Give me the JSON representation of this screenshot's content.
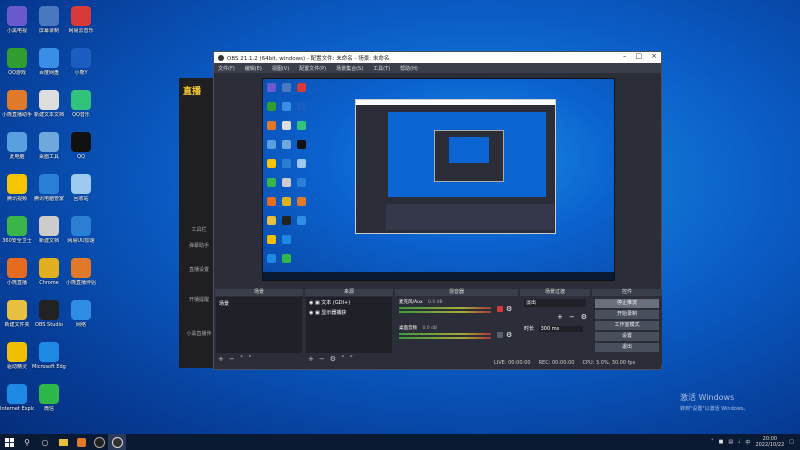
{
  "desktop": {
    "icons": [
      {
        "label": "小黑电视",
        "color": "#6a5acd"
      },
      {
        "label": "QQ游戏",
        "color": "#2f9d2f"
      },
      {
        "label": "小熊直播助手",
        "color": "#e07a2a"
      },
      {
        "label": "此电脑",
        "color": "#5aa0e0"
      },
      {
        "label": "腾讯视频",
        "color": "#f5c400"
      },
      {
        "label": "360安全卫士",
        "color": "#39b54a"
      },
      {
        "label": "小熊直播",
        "color": "#e56b1f"
      },
      {
        "label": "新建文件夹",
        "color": "#e8c040"
      },
      {
        "label": "驱动精灵",
        "color": "#f0c000"
      },
      {
        "label": "Internet Explorer",
        "color": "#1e88e5"
      },
      {
        "label": "屏幕录制",
        "color": "#4a78c0"
      },
      {
        "label": "百度网盘",
        "color": "#3a8ee6"
      },
      {
        "label": "新建文本文档",
        "color": "#dddddd"
      },
      {
        "label": "桌面工具",
        "color": "#6fa8dc"
      },
      {
        "label": "腾讯电脑管家",
        "color": "#2a7fd4"
      },
      {
        "label": "新建文档",
        "color": "#cccccc"
      },
      {
        "label": "Chrome",
        "color": "#e0b020"
      },
      {
        "label": "OBS Studio",
        "color": "#222222"
      },
      {
        "label": "Microsoft Edge",
        "color": "#1e88e5"
      },
      {
        "label": "微信",
        "color": "#2fb84a"
      },
      {
        "label": "网易云音乐",
        "color": "#d83a3a"
      },
      {
        "label": "小熊Y",
        "color": "#1a5cbf"
      },
      {
        "label": "QQ音乐",
        "color": "#31c27c"
      },
      {
        "label": "QQ",
        "color": "#111111"
      },
      {
        "label": "回收站",
        "color": "#9ec9ef"
      },
      {
        "label": "网易UU加速",
        "color": "#2a7fd4"
      },
      {
        "label": "小熊直播伴侣",
        "color": "#e07a2a"
      },
      {
        "label": "网络",
        "color": "#2f8de6"
      }
    ]
  },
  "background_app": {
    "logo": "直播",
    "items": [
      "工具栏",
      "弹幕助手",
      "直播设置",
      "开播提醒",
      "小黑直播伴"
    ]
  },
  "obs": {
    "title": "OBS 21.1.2 (64bit, windows) - 配置文件: 未命名 - 场景: 未命名",
    "menu": [
      "文件(F)",
      "编辑(E)",
      "视图(V)",
      "配置文件(P)",
      "场景集合(S)",
      "工具(T)",
      "帮助(H)"
    ],
    "docks": {
      "scenes": {
        "header": "场景",
        "items": [
          "场景"
        ]
      },
      "sources": {
        "header": "来源",
        "items": [
          "文本 (GDI+)",
          "显示器捕获"
        ]
      },
      "mixer": {
        "header": "混音器",
        "tracks": [
          {
            "name": "麦克风/Aux",
            "level": "0.0 dB"
          },
          {
            "name": "桌面音频",
            "level": "0.0 dB"
          }
        ]
      },
      "transitions": {
        "header": "场景过渡",
        "type": "淡出",
        "duration_label": "时长",
        "duration": "300 ms"
      },
      "controls": {
        "header": "控件",
        "buttons": [
          "停止推流",
          "开始录制",
          "工作室模式",
          "设置",
          "退出"
        ]
      }
    },
    "status": {
      "live": "LIVE: 00:00:00",
      "rec": "REC: 00:00:00",
      "cpu": "CPU: 3.0%, 30.00 fps"
    }
  },
  "taskbar": {
    "time": "20:00",
    "date": "2022/10/22"
  },
  "activation": {
    "line1": "激活 Windows",
    "line2": "转到\"设置\"以激活 Windows。"
  }
}
